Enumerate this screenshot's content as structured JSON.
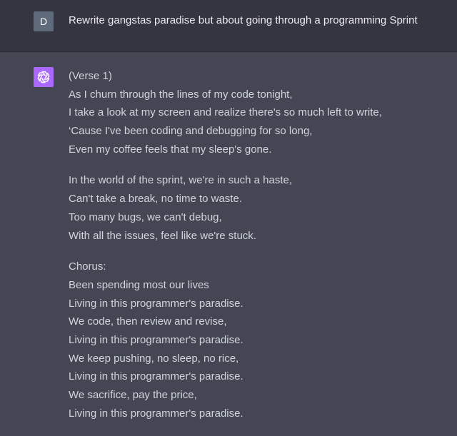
{
  "user_message": {
    "avatar_letter": "D",
    "text": "Rewrite gangstas paradise but about going through a programming Sprint"
  },
  "assistant_message": {
    "avatar_icon": "openai-logo-icon",
    "avatar_color": "#ab68ff",
    "stanzas": [
      [
        "(Verse 1)",
        "As I churn through the lines of my code tonight,",
        "I take a look at my screen and realize there's so much left to write,",
        "‘Cause I've been coding and debugging for so long,",
        "Even my coffee feels that my sleep's gone."
      ],
      [
        "In the world of the sprint, we're in such a haste,",
        "Can't take a break, no time to waste.",
        "Too many bugs, we can't debug,",
        "With all the issues, feel like we're stuck."
      ],
      [
        "Chorus:",
        "Been spending most our lives",
        "Living in this programmer's paradise.",
        "We code, then review and revise,",
        "Living in this programmer's paradise.",
        "We keep pushing, no sleep, no rice,",
        "Living in this programmer's paradise.",
        "We sacrifice, pay the price,",
        "Living in this programmer's paradise."
      ]
    ]
  }
}
